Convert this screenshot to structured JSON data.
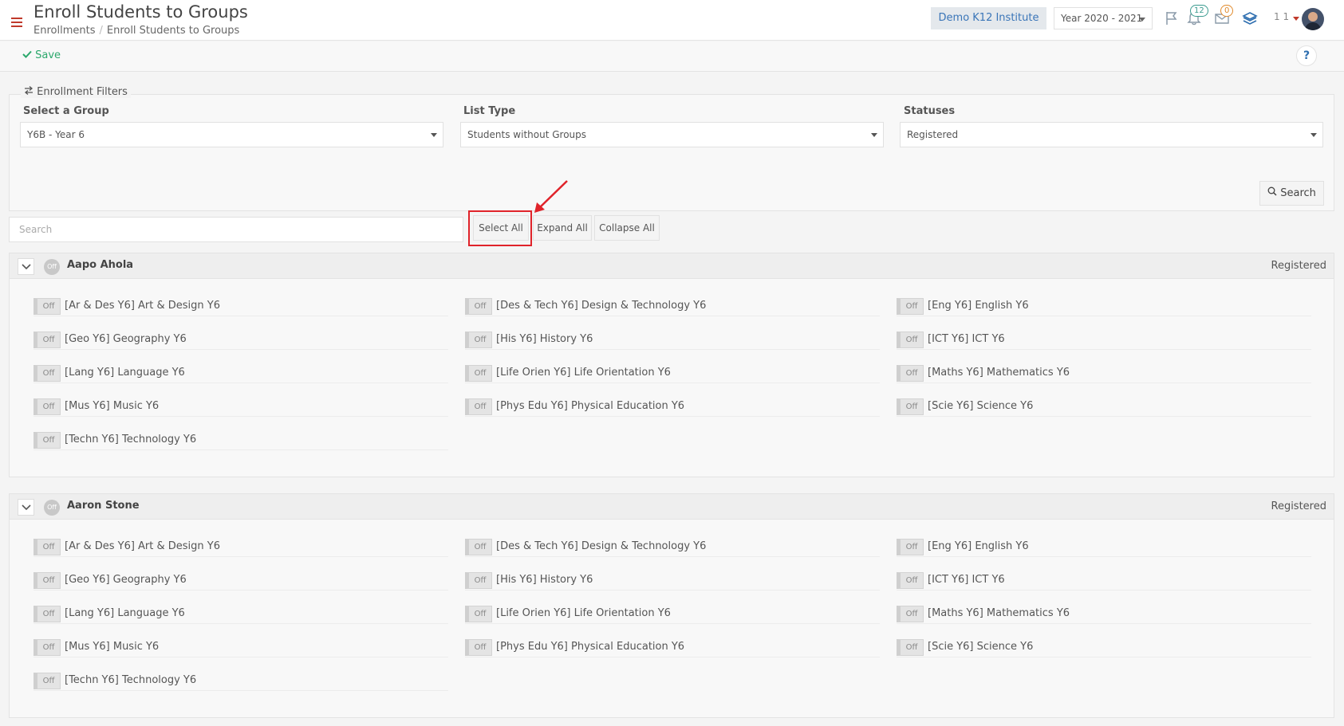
{
  "header": {
    "title": "Enroll Students to Groups",
    "breadcrumb": [
      "Enrollments",
      "Enroll Students to Groups"
    ],
    "institute": "Demo K12 Institute",
    "year": "Year 2020 - 2021",
    "notifications_count": "12",
    "messages_count": "0",
    "user_label": "1 1"
  },
  "toolbar": {
    "save_label": "Save",
    "help_label": "?"
  },
  "filters": {
    "legend": "Enrollment Filters",
    "group_label": "Select a Group",
    "group_value": "Y6B - Year 6",
    "list_type_label": "List Type",
    "list_type_value": "Students without Groups",
    "statuses_label": "Statuses",
    "statuses_value": "Registered",
    "search_button": "Search"
  },
  "list_tools": {
    "search_placeholder": "Search",
    "select_all": "Select All",
    "expand_all": "Expand All",
    "collapse_all": "Collapse All"
  },
  "toggle_off": "Off",
  "students": [
    {
      "name": "Aapo Ahola",
      "status": "Registered",
      "subjects": [
        "[Ar & Des Y6] Art & Design Y6",
        "[Des & Tech Y6] Design & Technology Y6",
        "[Eng Y6] English Y6",
        "[Geo Y6] Geography Y6",
        "[His Y6] History Y6",
        "[ICT Y6] ICT Y6",
        "[Lang Y6] Language Y6",
        "[Life Orien Y6] Life Orientation Y6",
        "[Maths Y6] Mathematics Y6",
        "[Mus Y6] Music Y6",
        "[Phys Edu Y6] Physical Education Y6",
        "[Scie Y6] Science Y6",
        "[Techn Y6] Technology Y6"
      ]
    },
    {
      "name": "Aaron Stone",
      "status": "Registered",
      "subjects": [
        "[Ar & Des Y6] Art & Design Y6",
        "[Des & Tech Y6] Design & Technology Y6",
        "[Eng Y6] English Y6",
        "[Geo Y6] Geography Y6",
        "[His Y6] History Y6",
        "[ICT Y6] ICT Y6",
        "[Lang Y6] Language Y6",
        "[Life Orien Y6] Life Orientation Y6",
        "[Maths Y6] Mathematics Y6",
        "[Mus Y6] Music Y6",
        "[Phys Edu Y6] Physical Education Y6",
        "[Scie Y6] Science Y6",
        "[Techn Y6] Technology Y6"
      ]
    }
  ],
  "colors": {
    "accent_red": "#e0232a",
    "save_green": "#2ca86c",
    "institute_blue": "#3a75b8"
  }
}
